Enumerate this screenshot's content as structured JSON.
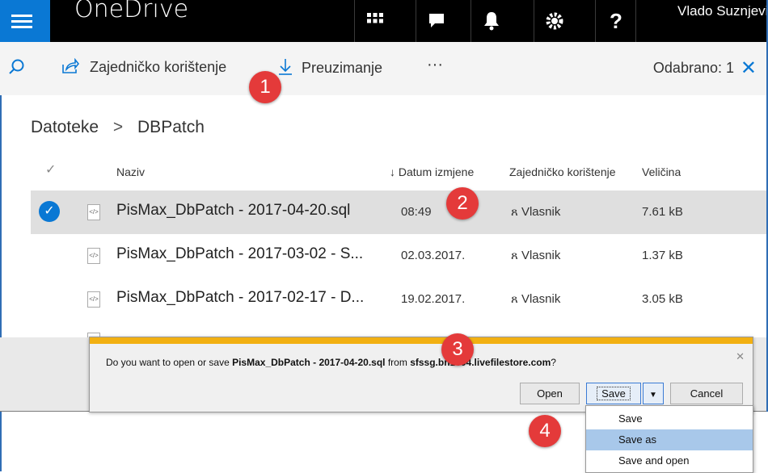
{
  "topbar": {
    "app_title": "OneDrive",
    "user_name": "Vlado Suznjevic"
  },
  "commandbar": {
    "share_label": "Zajedničko korištenje",
    "download_label": "Preuzimanje",
    "more_label": "···",
    "selected_text": "Odabrano: 1"
  },
  "breadcrumb": {
    "root": "Datoteke",
    "current": "DBPatch"
  },
  "columns": {
    "name": "Naziv",
    "date": "Datum izmjene",
    "sharing": "Zajedničko korištenje",
    "size": "Veličina"
  },
  "files": [
    {
      "name": "PisMax_DbPatch - 2017-04-20.sql",
      "date": "08:49",
      "sharing": "Vlasnik",
      "size": "7.61 kB"
    },
    {
      "name": "PisMax_DbPatch - 2017-03-02 - S...",
      "date": "02.03.2017.",
      "sharing": "Vlasnik",
      "size": "1.37 kB"
    },
    {
      "name": "PisMax_DbPatch - 2017-02-17 - D...",
      "date": "19.02.2017.",
      "sharing": "Vlasnik",
      "size": "3.05 kB"
    }
  ],
  "dialog": {
    "msg_prefix": "Do you want to open or save ",
    "msg_file": "PisMax_DbPatch - 2017-04-20.sql",
    "msg_mid": " from ",
    "msg_host": "sfssg.bn1304.livefilestore.com",
    "msg_suffix": "?",
    "open_label": "Open",
    "save_label": "Save",
    "cancel_label": "Cancel"
  },
  "save_menu": {
    "items": [
      "Save",
      "Save as",
      "Save and open"
    ]
  },
  "badges": [
    "1",
    "2",
    "3",
    "4"
  ]
}
